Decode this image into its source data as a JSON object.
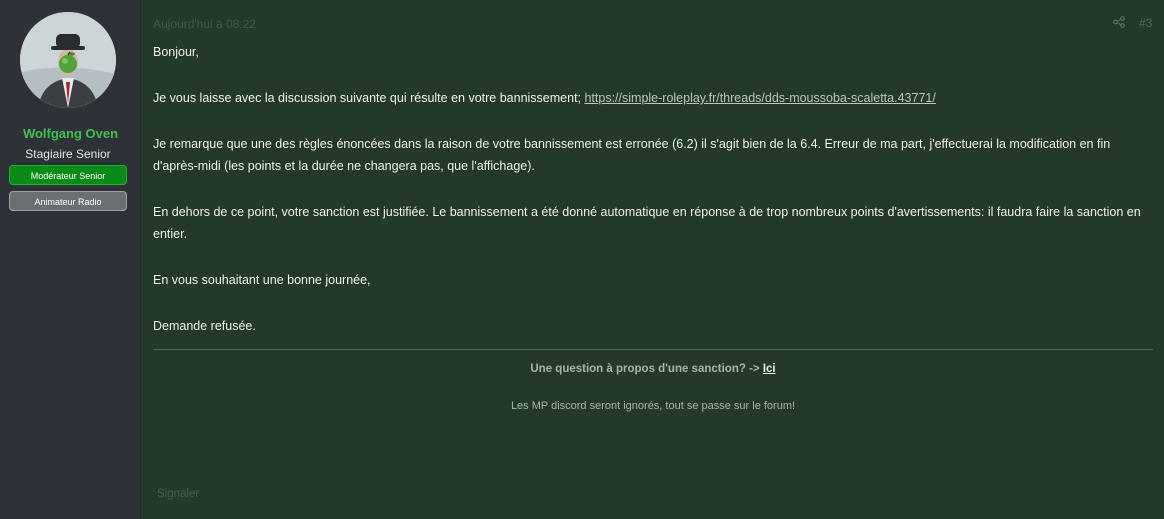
{
  "user": {
    "name": "Wolfgang Oven",
    "title": "Stagiaire Senior",
    "banners": [
      "Modérateur Senior",
      "Animateur Radio"
    ]
  },
  "post": {
    "date": "Aujourd'hui à 08:22",
    "number": "#3",
    "paragraphs": {
      "greeting": "Bonjour,",
      "p1_text": "Je vous laisse avec la discussion suivante qui résulte en votre bannissement; ",
      "p1_link": "https://simple-roleplay.fr/threads/dds-moussoba-scaletta.43771/",
      "p2": "Je remarque que une des règles énoncées dans la raison de votre bannissement est erronée (6.2) il s'agit bien de la 6.4. Erreur de ma part, j'effectuerai la modification en fin d'après-midi (les points et la durée ne changera pas, que l'affichage).",
      "p3": "En dehors de ce point, votre sanction est justifiée. Le bannissement a été donné automatique en réponse à de trop nombreux points d'avertissements: il faudra faire la sanction en entier.",
      "p4": "En vous souhaitant une bonne journée,",
      "p5": "Demande refusée."
    },
    "signature": {
      "question": "Une question à propos d'une sanction? -> ",
      "question_link": "Ici",
      "mp_note": "Les MP discord seront ignorés, tout se passe sur le forum!"
    },
    "report_label": "Signaler"
  },
  "icons": {
    "share": "share-icon"
  },
  "colors": {
    "username": "#3ec24f",
    "main_bg": "#243a29",
    "sidebar_bg": "#2e3238",
    "banner_mod": "#0a8a16",
    "banner_anim": "#6c6f72"
  }
}
